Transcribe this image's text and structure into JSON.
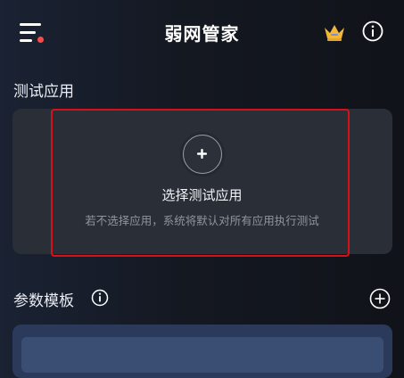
{
  "header": {
    "title": "弱网管家"
  },
  "test_app_section": {
    "title": "测试应用",
    "choose_label": "选择测试应用",
    "hint": "若不选择应用，系统将默认对所有应用执行测试"
  },
  "template_section": {
    "title": "参数模板"
  },
  "icons": {
    "menu": "menu-icon",
    "notification": "red-dot",
    "vip": "crown-icon",
    "info": "info-icon",
    "add": "plus-icon"
  },
  "colors": {
    "notification_dot": "#ff4a4a",
    "crown": "#f2b63a",
    "highlight_border": "#d6111a"
  }
}
